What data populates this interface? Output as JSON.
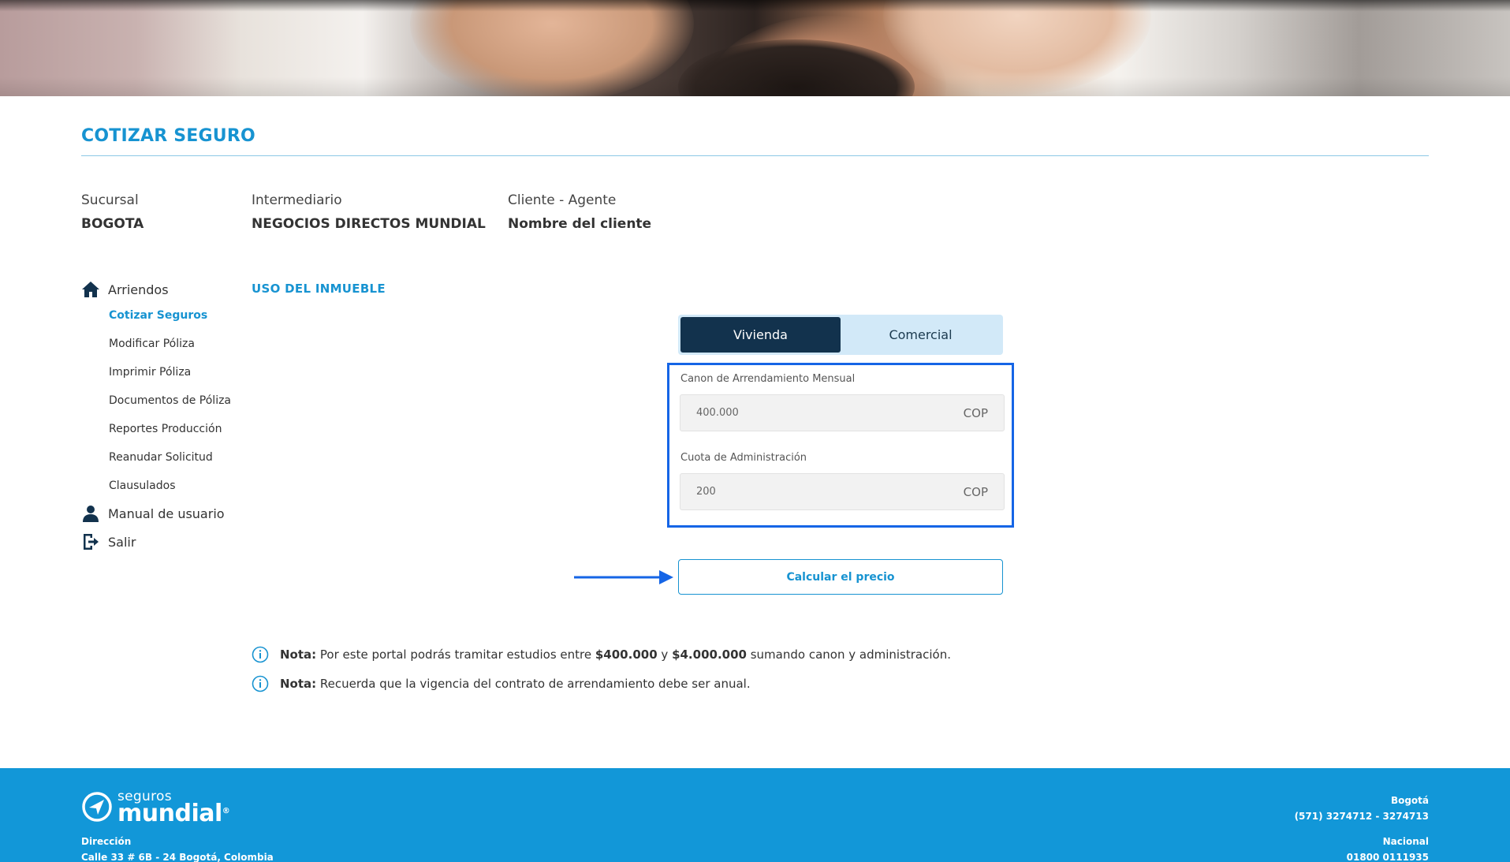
{
  "header": {
    "page_title": "COTIZAR SEGURO",
    "sucursal_label": "Sucursal",
    "sucursal_value": "BOGOTA",
    "intermediario_label": "Intermediario",
    "intermediario_value": "NEGOCIOS DIRECTOS MUNDIAL",
    "cliente_label": "Cliente - Agente",
    "cliente_value": "Nombre del cliente"
  },
  "sidebar": {
    "arriendos_label": "Arriendos",
    "items": [
      {
        "label": "Cotizar Seguros",
        "active": true
      },
      {
        "label": "Modificar Póliza",
        "active": false
      },
      {
        "label": "Imprimir Póliza",
        "active": false
      },
      {
        "label": "Documentos de Póliza",
        "active": false
      },
      {
        "label": "Reportes Producción",
        "active": false
      },
      {
        "label": "Reanudar Solicitud",
        "active": false
      },
      {
        "label": "Clausulados",
        "active": false
      }
    ],
    "manual_label": "Manual de usuario",
    "salir_label": "Salir"
  },
  "main": {
    "section_title": "USO DEL INMUEBLE",
    "toggle": {
      "vivienda": "Vivienda",
      "comercial": "Comercial",
      "selected": "Vivienda"
    },
    "canon": {
      "label": "Canon de Arrendamiento Mensual",
      "value": "400.000",
      "currency": "COP"
    },
    "cuota": {
      "label": "Cuota de Administración",
      "value": "200",
      "currency": "COP"
    },
    "calc_button": "Calcular el precio",
    "notes": [
      {
        "prefix": "Nota:",
        "text_a": " Por este portal podrás tramitar estudios entre ",
        "bold_a": "$400.000",
        "text_b": " y ",
        "bold_b": "$4.000.000",
        "text_c": " sumando canon y administración."
      },
      {
        "prefix": "Nota:",
        "text_a": " Recuerda que la vigencia del contrato de arrendamiento debe ser anual."
      }
    ]
  },
  "footer": {
    "logo_small": "seguros",
    "logo_big": "mundial",
    "logo_reg": "®",
    "direccion_label": "Dirección",
    "direccion_value": "Calle 33 # 6B - 24 Bogotá, Colombia",
    "bogota_label": "Bogotá",
    "bogota_phone": "(571) 3274712 - 3274713",
    "nacional_label": "Nacional",
    "nacional_phone": "01800 0111935"
  },
  "colors": {
    "accent": "#1793d1",
    "toggle_active": "#12324d",
    "toggle_bg": "#d2e9f8",
    "highlight_box": "#1565e6",
    "footer_bg": "#1297d8"
  },
  "icons": [
    "home-icon",
    "user-icon",
    "logout-icon",
    "info-icon",
    "arrow-right-icon",
    "logo-icon"
  ]
}
